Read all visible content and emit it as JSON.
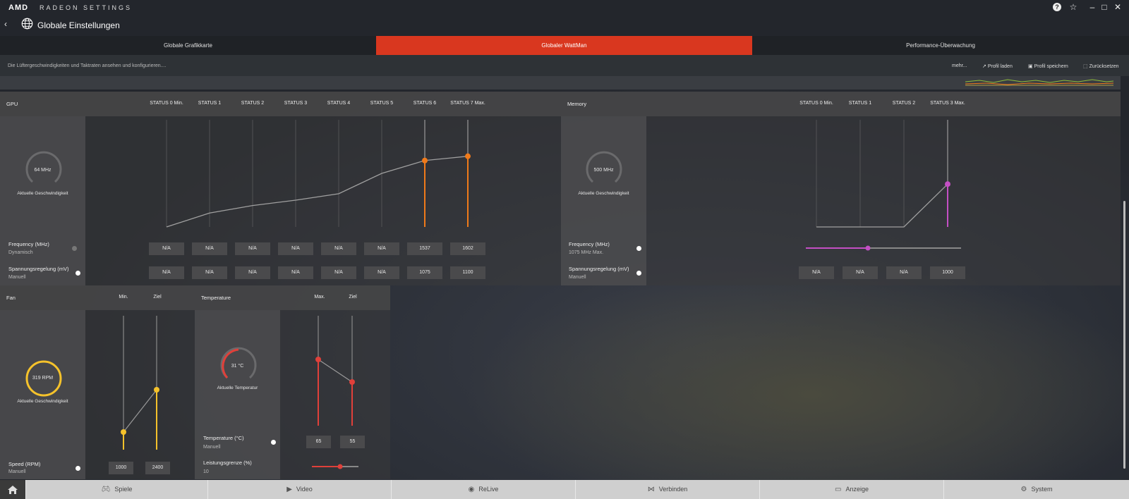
{
  "app": {
    "brand": "AMD",
    "product": "RADEON SETTINGS",
    "page_title": "Globale Einstellungen"
  },
  "tabs": [
    "Globale Grafikkarte",
    "Globaler WattMan",
    "Performance-Überwachung"
  ],
  "subbar": {
    "description": "Die Lüftergeschwindigkeiten und Taktraten ansehen und konfigurieren....",
    "more": "mehr...",
    "load": "Profil laden",
    "save": "Profil speichern",
    "reset": "Zurücksetzen"
  },
  "gpu": {
    "title": "GPU",
    "states": [
      "STATUS 0 Min.",
      "STATUS 1",
      "STATUS 2",
      "STATUS 3",
      "STATUS 4",
      "STATUS 5",
      "STATUS 6",
      "STATUS 7 Max."
    ],
    "gauge_value": "64 MHz",
    "gauge_label": "Aktuelle Geschwindigkeit",
    "freq_label": "Frequency (MHz)",
    "freq_mode": "Dynamisch",
    "volt_label": "Spannungsregelung (mV)",
    "volt_mode": "Manuell",
    "freq": [
      "N/A",
      "N/A",
      "N/A",
      "N/A",
      "N/A",
      "N/A",
      "1537",
      "1602"
    ],
    "volt": [
      "N/A",
      "N/A",
      "N/A",
      "N/A",
      "N/A",
      "N/A",
      "1075",
      "1100"
    ],
    "curve": [
      0.0,
      0.13,
      0.2,
      0.25,
      0.31,
      0.5,
      0.62,
      0.66
    ],
    "accent": "#f07a1a"
  },
  "memory": {
    "title": "Memory",
    "states": [
      "STATUS 0 Min.",
      "STATUS 1",
      "STATUS 2",
      "STATUS 3 Max."
    ],
    "gauge_value": "500 MHz",
    "gauge_label": "Aktuelle Geschwindigkeit",
    "freq_label": "Frequency (MHz)",
    "freq_mode": "1075 MHz Max.",
    "volt_label": "Spannungsregelung (mV)",
    "volt_mode": "Manuell",
    "volt": [
      "N/A",
      "N/A",
      "N/A",
      "1000"
    ],
    "curve": [
      0.0,
      0.0,
      0.0,
      0.4
    ],
    "slider_value": 0.4,
    "accent": "#c44fc4"
  },
  "fan": {
    "title": "Fan",
    "col_min": "Min.",
    "col_target": "Ziel",
    "gauge_value": "319 RPM",
    "gauge_label": "Aktuelle Geschwindigkeit",
    "speed_label": "Speed (RPM)",
    "speed_mode": "Manuell",
    "min": "1000",
    "target": "2400",
    "accent": "#f5c22b"
  },
  "temp": {
    "title": "Temperature",
    "col_max": "Max.",
    "col_target": "Ziel",
    "gauge_value": "31 °C",
    "gauge_label": "Aktuelle Temperatur",
    "temp_label": "Temperature (°C)",
    "temp_mode": "Manuell",
    "max": "65",
    "target": "55",
    "power_label": "Leistungsgrenze (%)",
    "power_value": "10",
    "accent": "#e0403a"
  },
  "bottom_nav": [
    "Spiele",
    "Video",
    "ReLive",
    "Verbinden",
    "Anzeige",
    "System"
  ]
}
